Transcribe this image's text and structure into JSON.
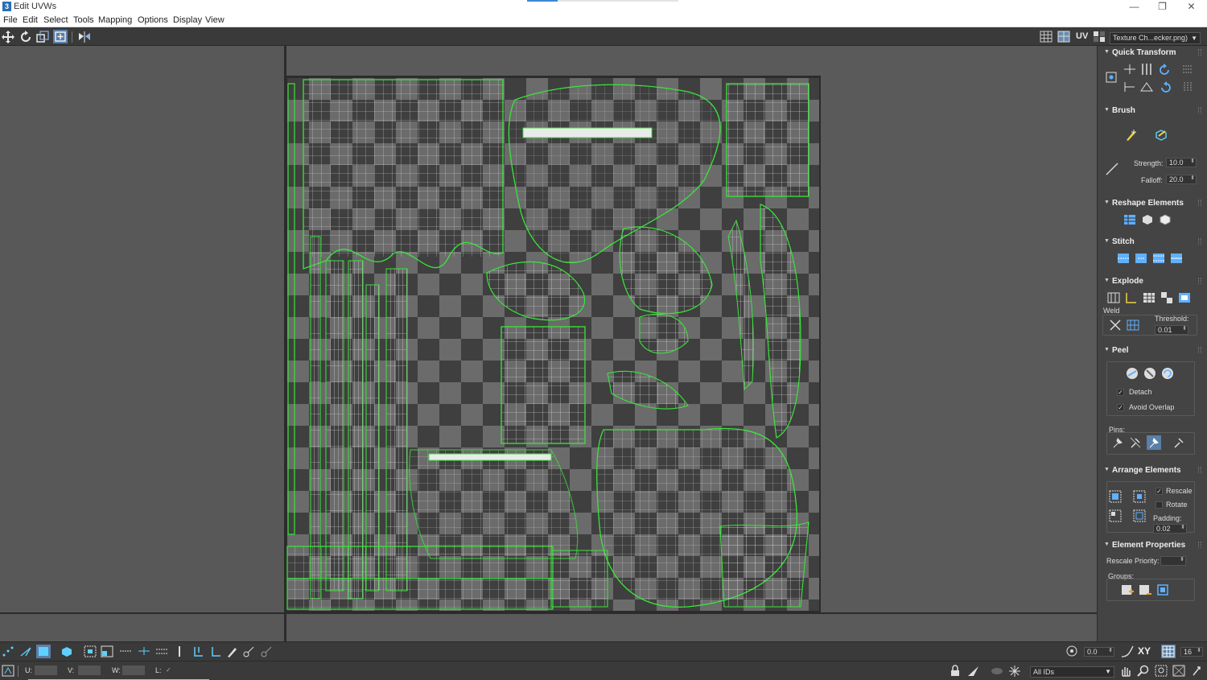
{
  "window": {
    "title": "Edit UVWs",
    "app_icon_letter": "3",
    "minimize": "—",
    "restore": "❐",
    "close": "✕"
  },
  "menu": {
    "items": [
      "File",
      "Edit",
      "Select",
      "Tools",
      "Mapping",
      "Options",
      "Display",
      "View"
    ]
  },
  "toolbar": {
    "uv_label": "UV",
    "texture_dropdown": "Texture Ch...ecker.png)"
  },
  "panel": {
    "quick_transform": {
      "title": "Quick Transform"
    },
    "brush": {
      "title": "Brush",
      "strength_label": "Strength:",
      "strength_value": "10.0",
      "falloff_label": "Falloff:",
      "falloff_value": "20.0"
    },
    "reshape": {
      "title": "Reshape Elements"
    },
    "stitch": {
      "title": "Stitch"
    },
    "explode": {
      "title": "Explode",
      "weld_label": "Weld",
      "threshold_label": "Threshold:",
      "threshold_value": "0.01"
    },
    "peel": {
      "title": "Peel",
      "detach_label": "Detach",
      "detach_checked": true,
      "avoid_overlap_label": "Avoid Overlap",
      "avoid_overlap_checked": true,
      "pins_label": "Pins:"
    },
    "arrange": {
      "title": "Arrange Elements",
      "rescale_label": "Rescale",
      "rescale_checked": true,
      "rotate_label": "Rotate",
      "rotate_checked": false,
      "padding_label": "Padding:",
      "padding_value": "0.02"
    },
    "element_props": {
      "title": "Element Properties",
      "rescale_priority_label": "Rescale Priority:",
      "groups_label": "Groups:"
    }
  },
  "bottombar": {
    "angle_value": "0.0",
    "xy_label": "XY",
    "grid_value": "16"
  },
  "statusbar": {
    "u_label": "U:",
    "v_label": "V:",
    "w_label": "W:",
    "l_label": "L:",
    "ids_dropdown": "All IDs"
  },
  "colors": {
    "uv_edge": "#39e639",
    "checker_dark": "#3f3f3f",
    "checker_light": "#6b6b6b",
    "panel_bg": "#444444",
    "accent_blue": "#3b87d8"
  }
}
